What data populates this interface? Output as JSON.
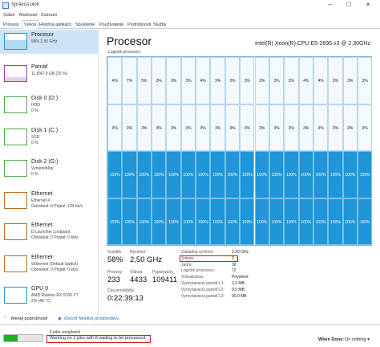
{
  "window": {
    "title": "Správca úloh",
    "min": "─",
    "max": "☐",
    "close": "✕"
  },
  "menu": [
    "Súbor",
    "Možnosti",
    "Zobraziť"
  ],
  "tabs": [
    "Procesy",
    "Výkon",
    "História aplikácií",
    "Spustenie",
    "Používatelia",
    "Podrobnosti",
    "Služby"
  ],
  "active_tab": "Výkon",
  "sidebar": {
    "items": [
      {
        "name": "Procesor",
        "sub": [
          "58% 2,50 GHz"
        ],
        "icon": "cpu-graph-icon",
        "color": "#1e96d8"
      },
      {
        "name": "Pamäť",
        "sub": [
          "11,8/47,9 GB (25 %)"
        ],
        "icon": "memory-graph-icon",
        "color": "#9b3fb5"
      },
      {
        "name": "Disk 0 (D:)",
        "sub": [
          "HDD",
          "0 %"
        ],
        "icon": "disk-graph-icon",
        "color": "#4fa84a"
      },
      {
        "name": "Disk 1 (C:)",
        "sub": [
          "SSD",
          "0 %"
        ],
        "icon": "disk-graph-icon",
        "color": "#4fa84a"
      },
      {
        "name": "Disk 2 (G:)",
        "sub": [
          "Vymeniteľný",
          "0 %"
        ],
        "icon": "disk-graph-icon",
        "color": "#4fa84a"
      },
      {
        "name": "Ethernet",
        "sub": [
          "Ethernet 4",
          "Odoslané: 0  Prijaté: 104 kb/s"
        ],
        "icon": "ethernet-graph-icon",
        "color": "#b76d1f"
      },
      {
        "name": "Ethernet",
        "sub": [
          "D.Launcher Loopback",
          "Odoslané: 0  Prijaté: 0 kb/s"
        ],
        "icon": "ethernet-graph-icon",
        "color": "#b76d1f"
      },
      {
        "name": "Ethernet",
        "sub": [
          "vEthernet (Default Switch)",
          "Odoslané: 0  Prijaté: 0 kb/s"
        ],
        "icon": "ethernet-graph-icon",
        "color": "#b76d1f"
      },
      {
        "name": "GPU 0",
        "sub": [
          "AMD Radeon RX 5700 XT",
          "2% (48 °C)"
        ],
        "icon": "gpu-graph-icon",
        "color": "#1e96d8"
      }
    ]
  },
  "main": {
    "title": "Procesor",
    "cpu_model": "Intel(R) Xeon(R) CPU E5-2696 v3 @ 2.30GHz",
    "grid_label": "Logické procesory",
    "cores_row1": [
      "4%",
      "7%",
      "5%",
      "3%",
      "3%",
      "3%",
      "4%",
      "3%",
      "3%",
      "3%",
      "3%",
      "3%",
      "3%",
      "4%",
      "4%",
      "3%",
      "3%",
      "3%"
    ],
    "cores_row2": [
      "3%",
      "3%",
      "3%",
      "3%",
      "3%",
      "3%",
      "3%",
      "3%",
      "3%",
      "3%",
      "3%",
      "3%",
      "3%",
      "3%",
      "3%",
      "3%",
      "3%",
      "3%"
    ],
    "cores_row3": [
      "100%",
      "100%",
      "100%",
      "100%",
      "100%",
      "100%",
      "100%",
      "100%",
      "100%",
      "100%",
      "100%",
      "100%",
      "100%",
      "100%",
      "100%",
      "100%",
      "100%",
      "100%"
    ],
    "cores_row4": [
      "100%",
      "100%",
      "100%",
      "100%",
      "100%",
      "100%",
      "100%",
      "100%",
      "100%",
      "100%",
      "100%",
      "100%",
      "100%",
      "100%",
      "100%",
      "100%",
      "100%",
      "100%"
    ]
  },
  "stats": {
    "utilization": {
      "label": "Využitie",
      "value": "58%"
    },
    "speed": {
      "label": "Rýchlosť",
      "value": "2,50 GHz"
    },
    "processes": {
      "label": "Procesy",
      "value": "233"
    },
    "threads": {
      "label": "Vlákna",
      "value": "4433"
    },
    "handles": {
      "label": "Popisovače",
      "value": "109411"
    },
    "uptime": {
      "label": "Čas prevádzky",
      "value": "0:22:39:13"
    }
  },
  "details": [
    {
      "label": "Základná rýchlosť:",
      "value": "2,30 GHz"
    },
    {
      "label": "Sokety:",
      "value": "2"
    },
    {
      "label": "Jadrá:",
      "value": "36"
    },
    {
      "label": "Logické procesory:",
      "value": "72"
    },
    {
      "label": "Virtualizácia:",
      "value": "Povolené"
    },
    {
      "label": "Vyrovnávacia pamäť L1:",
      "value": "2,3 MB"
    },
    {
      "label": "Vyrovnávacia pamäť L2:",
      "value": "9,0 MB"
    },
    {
      "label": "Vyrovnávacia pamäť L3:",
      "value": "90,0 MB"
    }
  ],
  "links": {
    "less_details": "Menej podrobností",
    "resource_monitor": "Otvoriť Monitor prostriedkov"
  },
  "status": {
    "progress": 0.35,
    "line1": "5 jobs completed",
    "line2": "Working on 2 jobs with 8 waiting to be processed.",
    "when_done_label": "When Done:",
    "when_done_value": "Do nothing"
  },
  "colors": {
    "accent": "#1e96d8",
    "highlight": "#d01717",
    "selected": "#cce4f7"
  }
}
